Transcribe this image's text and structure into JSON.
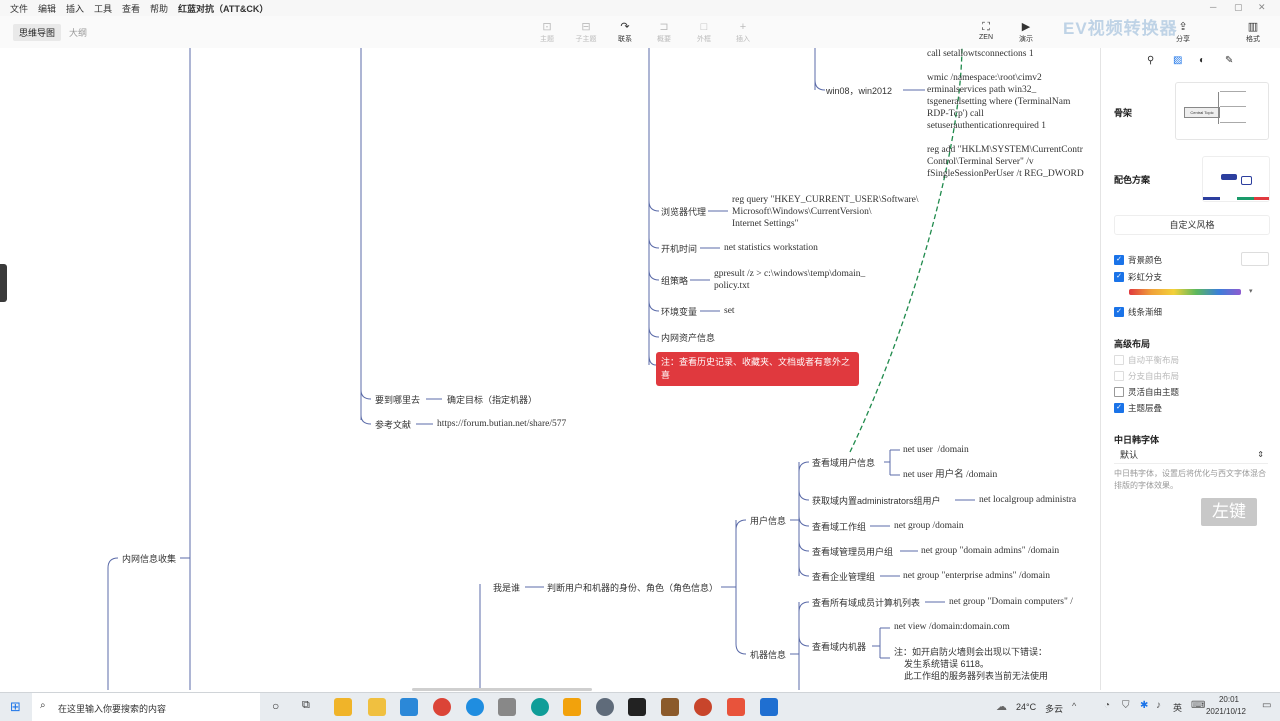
{
  "menu": {
    "items": [
      "文件",
      "编辑",
      "插入",
      "工具",
      "查看",
      "帮助"
    ],
    "doc_title": "红蓝对抗（ATT&CK）"
  },
  "toolbar": {
    "tabs": [
      "思维导图",
      "大纲"
    ],
    "buttons": [
      {
        "label": "主题",
        "enabled": false
      },
      {
        "label": "子主题",
        "enabled": false
      },
      {
        "label": "联系",
        "enabled": true
      },
      {
        "label": "概要",
        "enabled": false
      },
      {
        "label": "外框",
        "enabled": false
      },
      {
        "label": "插入",
        "enabled": false
      }
    ],
    "right_buttons": [
      "ZEN",
      "演示",
      "分享",
      "格式"
    ]
  },
  "watermark": "EV视频转换器",
  "mindmap": {
    "n_intranet": "内网信息收集",
    "n_where": "要到哪里去",
    "n_where_leaf": "确定目标（指定机器）",
    "n_ref": "参考文献",
    "n_ref_leaf": "https://forum.butian.net/share/577",
    "n_browser": "浏览器代理",
    "n_browser_leaf": "reg query \"HKEY_CURRENT_USER\\Software\\\nMicrosoft\\Windows\\CurrentVersion\\\nInternet Settings\"",
    "n_boot": "开机时间",
    "n_boot_leaf": "net statistics workstation",
    "n_gpo": "组策略",
    "n_gpo_leaf": "gpresult /z > c:\\windows\\temp\\domain_\npolicy.txt",
    "n_env": "环境变量",
    "n_env_leaf": "set",
    "n_assets": "内网资产信息",
    "n_note_red": "注：查看历史记录、收藏夹、文档或者有意外之喜",
    "n_win08": "win08，win2012",
    "n_top_leaf": "call setallowtsconnections 1",
    "n_wmic": "wmic /namespace:\\root\\cimv2\nerminalservices path win32_\ntsgeneralsetting where (TerminalNam\nRDP-Tcp') call\nsetuserauthenticationrequired 1",
    "n_reg": "reg add \"HKLM\\SYSTEM\\CurrentContr\nControl\\Terminal Server\" /v\nfSingleSessionPerUser /t REG_DWORD",
    "n_whoami": "我是谁",
    "n_identify": "判断用户和机器的身份、角色（角色信息）",
    "n_userinfo": "用户信息",
    "n_machineinfo": "机器信息",
    "n_domusers": "查看域用户信息",
    "n_domusers_leaf1": "net user  /domain",
    "n_domusers_leaf2": "net user 用户名 /domain",
    "n_domadmins_local": "获取域内置administrators组用户",
    "n_domadmins_local_leaf": "net localgroup administra",
    "n_domgroups": "查看域工作组",
    "n_domgroups_leaf": "net group /domain",
    "n_domadmingroup": "查看域管理员用户组",
    "n_domadmingroup_leaf": "net group \"domain admins\" /domain",
    "n_entadmin": "查看企业管理组",
    "n_entadmin_leaf": "net group \"enterprise admins\" /domain",
    "n_domcomputers": "查看所有域成员计算机列表",
    "n_domcomputers_leaf": "net group \"Domain computers\" /",
    "n_dommachines": "查看域内机器",
    "n_dommachines_leaf": "net view /domain:domain.com",
    "n_dommachines_note": "注：如开启防火墙则会出现以下错误：\n    发生系统错误 6118。\n    此工作组的服务器列表当前无法使用"
  },
  "panel": {
    "tabs": [
      "style-icon",
      "image-icon",
      "palette-icon",
      "brush-icon"
    ],
    "skeleton_label": "骨架",
    "skeleton_preview": "Central Topic",
    "color_scheme_label": "配色方案",
    "custom_style_button": "自定义风格",
    "bg_color": "背景颜色",
    "rainbow": "彩虹分支",
    "line_taper": "线条渐细",
    "advanced_layout": "高级布局",
    "auto_balance": "自动平衡布局",
    "branch_free": "分支自由布局",
    "flexible_topic": "灵活自由主题",
    "topic_overlap": "主题层叠",
    "cjk_font_title": "中日韩字体",
    "cjk_font_value": "默认",
    "cjk_font_desc": "中日韩字体，设置后将优化与西文字体混合排版的字体效果。",
    "left_key": "左键"
  },
  "taskbar": {
    "search_placeholder": "在这里输入你要搜索的内容",
    "weather": "24°C",
    "weather_desc": "多云",
    "ime": "英",
    "time": "20:01",
    "date": "2021/10/12"
  }
}
